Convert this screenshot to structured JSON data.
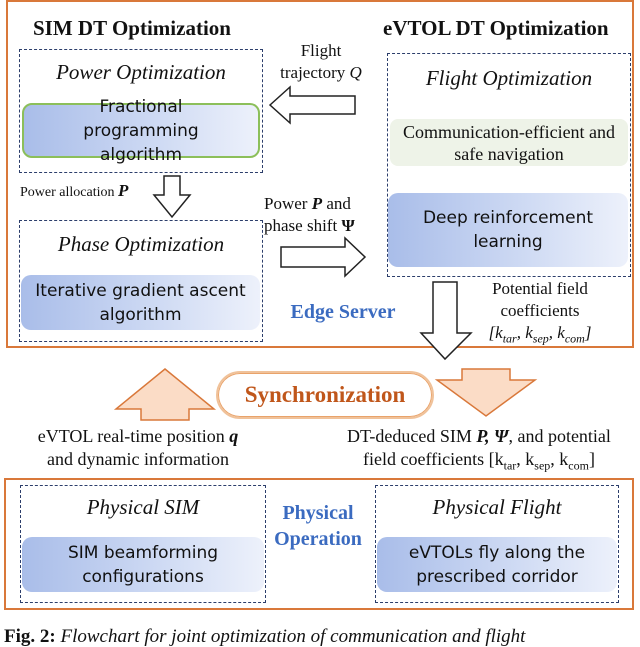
{
  "edge_server": {
    "label": "Edge Server",
    "sim_dt": {
      "title": "SIM DT Optimization",
      "power_opt": {
        "title": "Power Optimization",
        "algorithm": "Fractional programming algorithm"
      },
      "phase_opt": {
        "title": "Phase Optimization",
        "algorithm": "Iterative gradient ascent algorithm"
      }
    },
    "evtol_dt": {
      "title": "eVTOL DT Optimization",
      "flight_opt": {
        "title": "Flight Optimization",
        "goal": "Communication-efficient and safe navigation",
        "algorithm": "Deep reinforcement learning"
      }
    },
    "arrows": {
      "flight_trajectory_line1": "Flight",
      "flight_trajectory_line2": "trajectory",
      "flight_trajectory_symbol": "Q",
      "power_allocation": "Power allocation",
      "power_allocation_symbol": "P",
      "power_phase_line1_a": "Power",
      "power_phase_line1_sym": "P",
      "power_phase_line1_b": "and",
      "power_phase_line2": "phase shift",
      "power_phase_line2_sym": "Ψ",
      "potential_line1": "Potential field",
      "potential_line2": "coefficients",
      "potential_line3": "[k_tar, k_sep, k_com]"
    }
  },
  "synchronization": {
    "label": "Synchronization",
    "up_text_line1": "eVTOL real-time position",
    "up_text_symbol": "q",
    "up_text_line2": "and dynamic information",
    "down_text_line1_a": "DT-deduced SIM",
    "down_text_line1_sym": "P, Ψ",
    "down_text_line1_b": ", and potential",
    "down_text_line2": "field coefficients [k_tar, k_sep, k_com]"
  },
  "physical": {
    "label_line1": "Physical",
    "label_line2": "Operation",
    "sim": {
      "title": "Physical SIM",
      "action": "SIM beamforming configurations"
    },
    "flight": {
      "title": "Physical Flight",
      "action": "eVTOLs fly along the prescribed corridor"
    }
  },
  "caption": {
    "prefix": "Fig. 2:",
    "text": "Flowchart for joint optimization of communication and flight"
  },
  "colors": {
    "frame": "#d9783a",
    "blue_label": "#3b6bc0",
    "sync_text": "#c0561a",
    "sync_arrow_fill": "#fbdcc6"
  }
}
